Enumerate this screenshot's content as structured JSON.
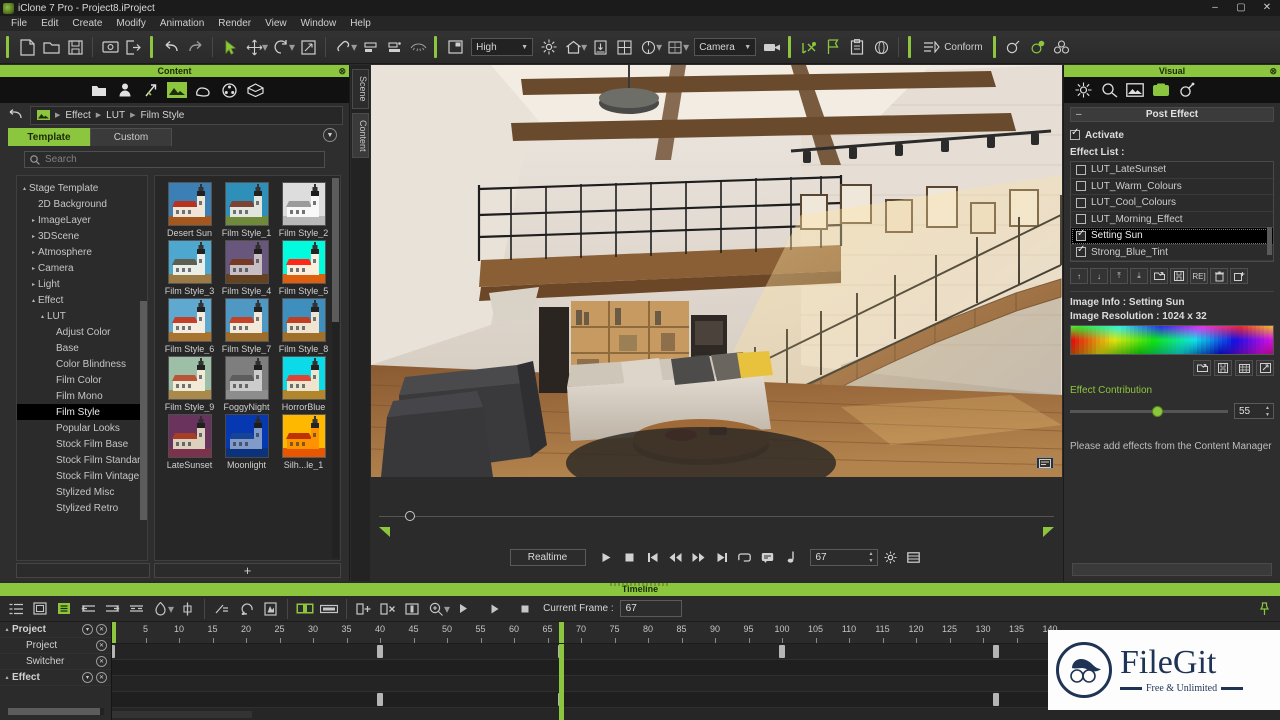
{
  "window": {
    "title": "iClone 7 Pro - Project8.iProject",
    "app_icon": "iclone-icon",
    "minimize": "–",
    "maximize": "▢",
    "close": "✕"
  },
  "menubar": {
    "items": [
      "File",
      "Edit",
      "Create",
      "Modify",
      "Animation",
      "Render",
      "View",
      "Window",
      "Help"
    ]
  },
  "toolbar": {
    "quality_value": "High",
    "camera_value": "Camera",
    "conform_label": "Conform",
    "icons": [
      "new-project-icon",
      "open-project-icon",
      "save-project-icon",
      "import-icon",
      "export-icon",
      "undo-icon",
      "redo-icon",
      "select-tool-icon",
      "move-tool-icon",
      "rotate-tool-icon",
      "scale-tool-icon",
      "link-icon",
      "align-icon",
      "align-distribute-icon",
      "preview-toggle-icon",
      "render-window-icon",
      "light-icon",
      "home-icon",
      "ground-icon",
      "grid-icon",
      "ik-icon",
      "physics-icon",
      "camera-switch-icon",
      "video-camera-icon",
      "motion-icon",
      "flag-icon",
      "clipboard-icon",
      "sphere-icon",
      "conform-icon",
      "soft-cloth-icon",
      "spring-icon",
      "particle-icon"
    ]
  },
  "content_panel": {
    "title": "Content",
    "close_icon": "close-icon",
    "icon_tabs": [
      {
        "name": "folder-tab",
        "active": false
      },
      {
        "name": "actor-tab",
        "active": false
      },
      {
        "name": "animation-tab",
        "active": false
      },
      {
        "name": "stage-tab",
        "active": true
      },
      {
        "name": "prop-tab",
        "active": false
      },
      {
        "name": "media-tab",
        "active": false
      },
      {
        "name": "pack-tab",
        "active": false
      }
    ],
    "breadcrumb": [
      "Effect",
      "LUT",
      "Film Style"
    ],
    "tabs": [
      {
        "label": "Template",
        "active": true
      },
      {
        "label": "Custom",
        "active": false
      }
    ],
    "search_placeholder": "Search",
    "tree": [
      {
        "label": "Stage Template",
        "indent": 0,
        "tri": "▴",
        "selected": false
      },
      {
        "label": "2D Background",
        "indent": 1,
        "tri": "",
        "selected": false
      },
      {
        "label": "ImageLayer",
        "indent": 1,
        "tri": "▸",
        "selected": false
      },
      {
        "label": "3DScene",
        "indent": 1,
        "tri": "▸",
        "selected": false
      },
      {
        "label": "Atmosphere",
        "indent": 1,
        "tri": "▸",
        "selected": false
      },
      {
        "label": "Camera",
        "indent": 1,
        "tri": "▸",
        "selected": false
      },
      {
        "label": "Light",
        "indent": 1,
        "tri": "▸",
        "selected": false
      },
      {
        "label": "Effect",
        "indent": 1,
        "tri": "▴",
        "selected": false
      },
      {
        "label": "LUT",
        "indent": 2,
        "tri": "▴",
        "selected": false
      },
      {
        "label": "Adjust Color",
        "indent": 3,
        "tri": "",
        "selected": false
      },
      {
        "label": "Base",
        "indent": 3,
        "tri": "",
        "selected": false
      },
      {
        "label": "Color Blindness",
        "indent": 3,
        "tri": "",
        "selected": false
      },
      {
        "label": "Film Color",
        "indent": 3,
        "tri": "",
        "selected": false
      },
      {
        "label": "Film Mono",
        "indent": 3,
        "tri": "",
        "selected": false
      },
      {
        "label": "Film Style",
        "indent": 3,
        "tri": "",
        "selected": true
      },
      {
        "label": "Popular Looks",
        "indent": 3,
        "tri": "",
        "selected": false
      },
      {
        "label": "Stock Film Base",
        "indent": 3,
        "tri": "",
        "selected": false
      },
      {
        "label": "Stock Film Standard",
        "indent": 3,
        "tri": "",
        "selected": false
      },
      {
        "label": "Stock Film Vintage",
        "indent": 3,
        "tri": "",
        "selected": false
      },
      {
        "label": "Stylized Misc",
        "indent": 3,
        "tri": "",
        "selected": false
      },
      {
        "label": "Stylized Retro",
        "indent": 3,
        "tri": "",
        "selected": false
      }
    ],
    "thumbnails": [
      {
        "label": "Desert Sun",
        "sky": "#3b7fb5",
        "roof": "#b8331f",
        "wall": "#f0e6d8",
        "ground": "#a4571f",
        "tone": "none"
      },
      {
        "label": "Film Style_1",
        "sky": "#2e8fb8",
        "roof": "#7d4435",
        "wall": "#e3e6de",
        "ground": "#6f8a3a",
        "tone": "none"
      },
      {
        "label": "Film Style_2",
        "sky": "#d9d9d9",
        "roof": "#9a9a9a",
        "wall": "#f2f2f2",
        "ground": "#b5b5b5",
        "tone": "gray"
      },
      {
        "label": "Film Style_3",
        "sky": "#4ea7cf",
        "roof": "#5d5f50",
        "wall": "#e9efe7",
        "ground": "#9c7a43",
        "tone": "none"
      },
      {
        "label": "Film Style_4",
        "sky": "#6a5f8e",
        "roof": "#8d3a2d",
        "wall": "#d9cfd8",
        "ground": "#7a4526",
        "tone": "violet"
      },
      {
        "label": "Film Style_5",
        "sky": "#24e3e3",
        "roof": "#c03a1c",
        "wall": "#f6efe0",
        "ground": "#b06a1c",
        "tone": "cyan"
      },
      {
        "label": "Film Style_6",
        "sky": "#5fa8cf",
        "roof": "#c2402a",
        "wall": "#f4ece0",
        "ground": "#a9742f",
        "tone": "none"
      },
      {
        "label": "Film Style_7",
        "sky": "#4f98c4",
        "roof": "#c34229",
        "wall": "#f2e9da",
        "ground": "#9c6d2b",
        "tone": "none"
      },
      {
        "label": "Film Style_8",
        "sky": "#3f8fbe",
        "roof": "#bf3f23",
        "wall": "#efe4d2",
        "ground": "#a06f2a",
        "tone": "none"
      },
      {
        "label": "Film Style_9",
        "sky": "#9dbfa8",
        "roof": "#b8543a",
        "wall": "#f0ead6",
        "ground": "#a98a4a",
        "tone": "none"
      },
      {
        "label": "FoggyNight",
        "sky": "#7a7f86",
        "roof": "#6e5b56",
        "wall": "#c9c9c6",
        "ground": "#8d8d85",
        "tone": "gray"
      },
      {
        "label": "HorrorBlue",
        "sky": "#48c8e8",
        "roof": "#b0523a",
        "wall": "#eae6d6",
        "ground": "#9b8a48",
        "tone": "cyan"
      },
      {
        "label": "LateSunset",
        "sky": "#6e3a62",
        "roof": "#a8452f",
        "wall": "#efe2cf",
        "ground": "#7e3a52",
        "tone": "magenta"
      },
      {
        "label": "Moonlight",
        "sky": "#1741a8",
        "roof": "#2a4f93",
        "wall": "#9fb6dd",
        "ground": "#1b3a78",
        "tone": "blue"
      },
      {
        "label": "Silh...le_1",
        "sky": "#e8b018",
        "roof": "#8c3a10",
        "wall": "#d98f12",
        "ground": "#b05a10",
        "tone": "amber"
      }
    ],
    "add_button": "+"
  },
  "viewport": {
    "tabs": [
      {
        "label": "Scene",
        "active": true
      },
      {
        "label": "Content",
        "active": false
      }
    ],
    "badge_icon": "viewport-info-icon",
    "mini_timeline_knob_frame": 4,
    "transport": {
      "mode": "Realtime",
      "buttons": [
        {
          "name": "play-button",
          "glyph": "▶"
        },
        {
          "name": "stop-button",
          "glyph": "■"
        },
        {
          "name": "goto-start-button",
          "glyph": "◀|"
        },
        {
          "name": "prev-frame-button",
          "glyph": "◀◀"
        },
        {
          "name": "next-frame-button",
          "glyph": "▶▶"
        },
        {
          "name": "goto-end-button",
          "glyph": "|▶"
        },
        {
          "name": "loop-button",
          "glyph": "loop-icon"
        },
        {
          "name": "caption-button",
          "glyph": "caption-icon"
        },
        {
          "name": "audio-note-button",
          "glyph": "♩"
        }
      ],
      "frame_value": "67",
      "settings_icon": "gear-icon",
      "list_icon": "list-icon"
    }
  },
  "visual_panel": {
    "title": "Visual",
    "close_icon": "close-icon",
    "icon_tabs": [
      {
        "name": "atmosphere-tab",
        "active": false
      },
      {
        "name": "lens-tab",
        "active": false
      },
      {
        "name": "image-tab",
        "active": false
      },
      {
        "name": "post-effect-tab",
        "active": true
      },
      {
        "name": "global-illumination-tab",
        "active": false
      }
    ],
    "section_header": "Post Effect",
    "collapse_glyph": "–",
    "activate_label": "Activate",
    "activate_checked": true,
    "effect_list_label": "Effect List :",
    "effect_list": [
      {
        "label": "LUT_LateSunset",
        "checked": false,
        "selected": false
      },
      {
        "label": "LUT_Warm_Colours",
        "checked": false,
        "selected": false
      },
      {
        "label": "LUT_Cool_Colours",
        "checked": false,
        "selected": false
      },
      {
        "label": "LUT_Morning_Effect",
        "checked": false,
        "selected": false
      },
      {
        "label": "Setting Sun",
        "checked": true,
        "selected": true
      },
      {
        "label": "Strong_Blue_Tint",
        "checked": true,
        "selected": false
      }
    ],
    "list_buttons": [
      {
        "name": "move-up-button",
        "glyph": "↑"
      },
      {
        "name": "move-down-button",
        "glyph": "↓"
      },
      {
        "name": "move-top-button",
        "glyph": "⤒"
      },
      {
        "name": "move-bottom-button",
        "glyph": "⤓"
      },
      {
        "name": "load-effect-button",
        "glyph": "load-icon"
      },
      {
        "name": "save-effect-button",
        "glyph": "save-icon"
      },
      {
        "name": "reset-effect-button",
        "glyph": "RE]"
      },
      {
        "name": "delete-effect-button",
        "glyph": "trash-icon"
      },
      {
        "name": "add-effect-button",
        "glyph": "add-icon"
      }
    ],
    "image_info_label": "Image Info :",
    "image_info_value": "Setting Sun",
    "image_resolution_label": "Image Resolution :",
    "image_resolution_value": "1024 x 32",
    "lut_buttons": [
      {
        "name": "lut-load-button",
        "glyph": "load-icon"
      },
      {
        "name": "lut-save-button",
        "glyph": "save-icon"
      },
      {
        "name": "lut-grid-button",
        "glyph": "grid-icon"
      },
      {
        "name": "lut-export-button",
        "glyph": "export-icon"
      }
    ],
    "contribution_label": "Effect Contribution",
    "contribution_value": "55",
    "contribution_percent": 55,
    "note": "Please add effects from the Content Manager",
    "accent_color": "#8cc63e"
  },
  "timeline": {
    "title": "Timeline",
    "toolbar_icons": [
      "track-list-icon",
      "insert-track-icon",
      "show-tracks-icon",
      "collapse-left-icon",
      "collapse-right-icon",
      "expand-icon",
      "sample-icon",
      "transition-icon",
      "align-keys-icon",
      "loop-clip-icon",
      "motion-clip-icon",
      "green-clip-icon",
      "clip-range-icon",
      "insert-frame-icon",
      "delete-frame-icon",
      "key-icon",
      "zoom-icon",
      "play-icon"
    ],
    "current_frame_label": "Current Frame :",
    "current_frame_value": "67",
    "pin_icon": "pin-icon",
    "ruler": {
      "start": 0,
      "end": 140,
      "labeled_ticks": [
        5,
        10,
        15,
        20,
        25,
        30,
        35,
        40,
        45,
        50,
        55,
        60,
        65,
        70,
        75,
        80,
        85,
        90,
        95,
        100,
        105,
        110,
        115,
        120,
        125,
        130,
        135,
        140
      ],
      "step": 5,
      "pixels_per_frame": 6.7
    },
    "playhead_frame": 67,
    "tracks": [
      {
        "label": "Project",
        "indent": 0,
        "tri": "▴",
        "has_menu": true,
        "keys": [
          0,
          40,
          67,
          100,
          132
        ]
      },
      {
        "label": "Project",
        "indent": 1,
        "tri": "",
        "has_menu": false,
        "keys": []
      },
      {
        "label": "Switcher",
        "indent": 1,
        "tri": "",
        "has_menu": false,
        "keys": []
      },
      {
        "label": "Effect",
        "indent": 0,
        "tri": "▴",
        "has_menu": true,
        "keys": [
          40,
          67,
          132
        ]
      }
    ]
  },
  "watermark": {
    "name": "FileGit",
    "tagline": "Free & Unlimited",
    "logo_icon": "filegit-logo-icon"
  }
}
